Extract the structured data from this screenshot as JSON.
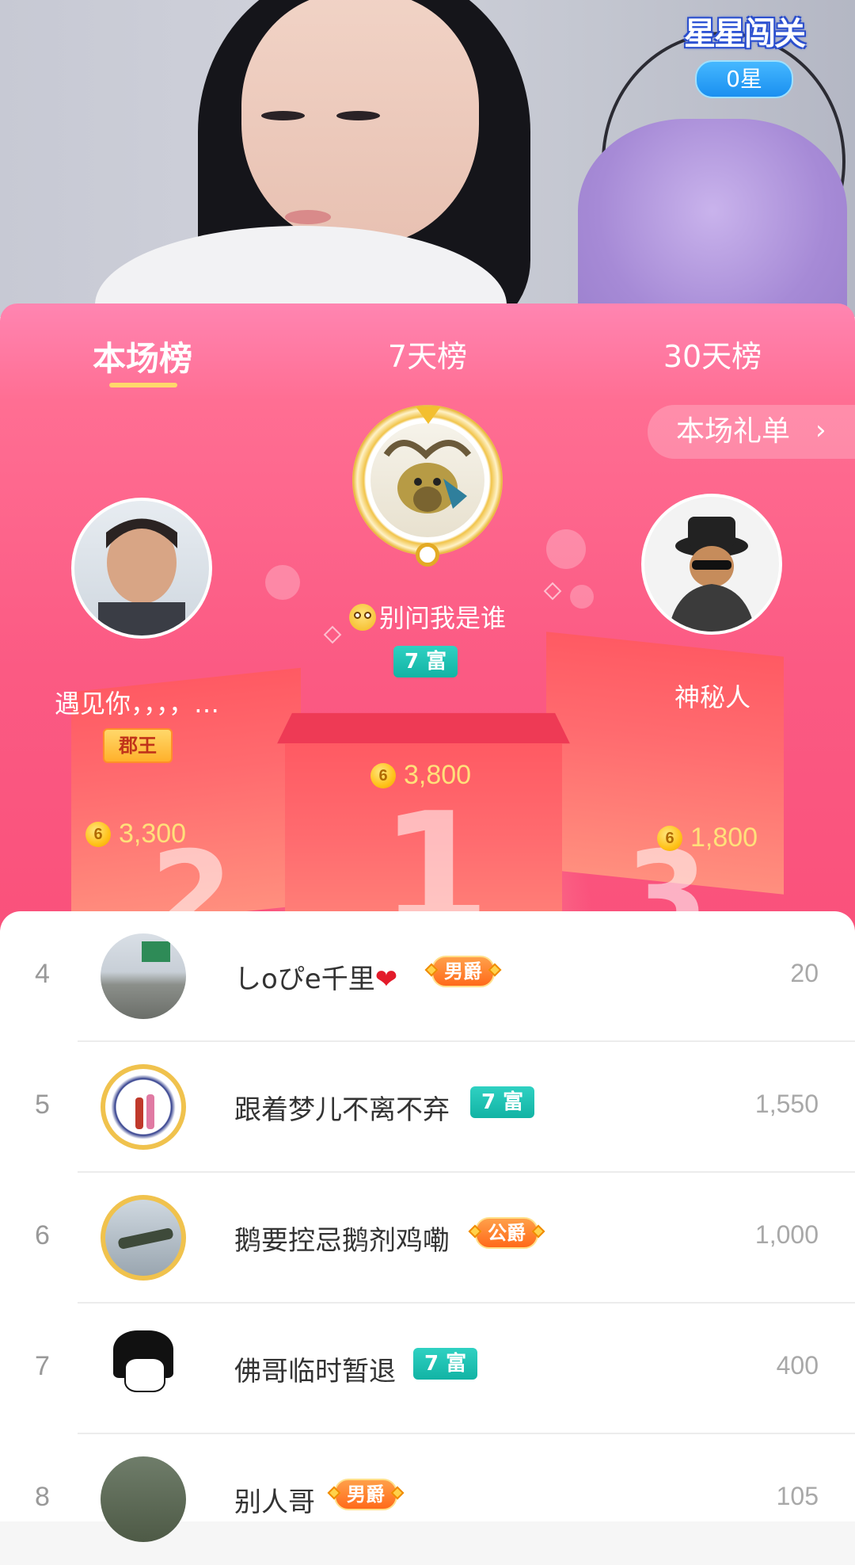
{
  "game_badge": {
    "title": "星星闯关",
    "stars": "0星"
  },
  "tabs": [
    {
      "label": "本场榜",
      "active": true
    },
    {
      "label": "7天榜",
      "active": false
    },
    {
      "label": "30天榜",
      "active": false
    }
  ],
  "gift_list_link": {
    "label": "本场礼单",
    "arrow": "›"
  },
  "podium": {
    "first": {
      "name": "别问我是谁",
      "badge": "7 富",
      "score": "3,800",
      "rank": "1"
    },
    "second": {
      "name": "遇见你，，，，…",
      "badge": "郡王",
      "score": "3,300",
      "rank": "2"
    },
    "third": {
      "name": "神秘人",
      "score": "1,800",
      "rank": "3"
    }
  },
  "coin_symbol": "6",
  "list": [
    {
      "rank": "4",
      "name": "しoぴe千里",
      "heart": "❤",
      "badge": "男爵",
      "badge_type": "orange",
      "value": "20"
    },
    {
      "rank": "5",
      "name": "跟着梦儿不离不弃",
      "badge": "7 富",
      "badge_type": "teal",
      "value": "1,550"
    },
    {
      "rank": "6",
      "name": "鹅要控忌鹅剂鸡嘞",
      "badge": "公爵",
      "badge_type": "orange",
      "value": "1,000"
    },
    {
      "rank": "7",
      "name": "佛哥临时暂退",
      "badge": "7 富",
      "badge_type": "teal",
      "value": "400"
    },
    {
      "rank": "8",
      "name": "别人哥",
      "badge": "男爵",
      "badge_type": "orange",
      "value": "105"
    }
  ],
  "colors": {
    "panel_pink": "#fb5a83",
    "gold": "#ffe07a",
    "teal_badge": "#12b3a4",
    "orange_badge": "#ff6a1a"
  }
}
